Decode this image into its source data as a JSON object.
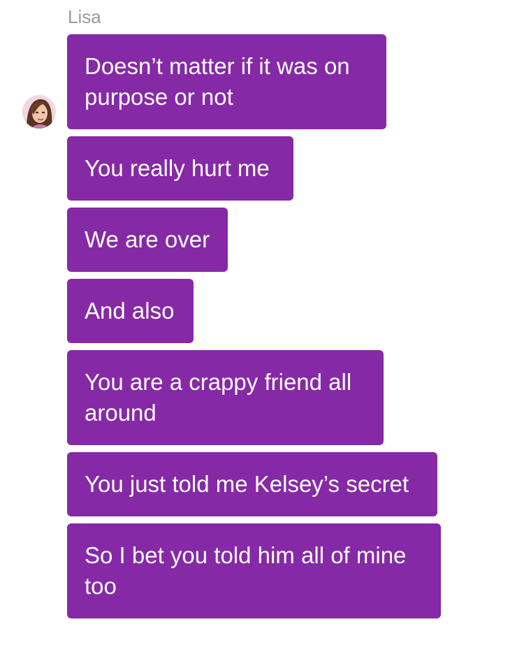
{
  "conversation": {
    "sender_name": "Lisa",
    "avatar_icon": "avatar-woman-icon",
    "bubble_color": "#8629a6",
    "text_color": "#ffffff",
    "messages": [
      {
        "lines": [
          "Doesn’t matter if it was on",
          "purpose or not"
        ]
      },
      {
        "lines": [
          "You really hurt me"
        ]
      },
      {
        "lines": [
          "We are over"
        ]
      },
      {
        "lines": [
          "And also"
        ]
      },
      {
        "lines": [
          "You are a crappy friend all",
          "around"
        ]
      },
      {
        "lines": [
          "You just told me Kelsey’s secret"
        ]
      },
      {
        "lines": [
          "So I bet you told him all of mine",
          "too"
        ]
      }
    ]
  }
}
